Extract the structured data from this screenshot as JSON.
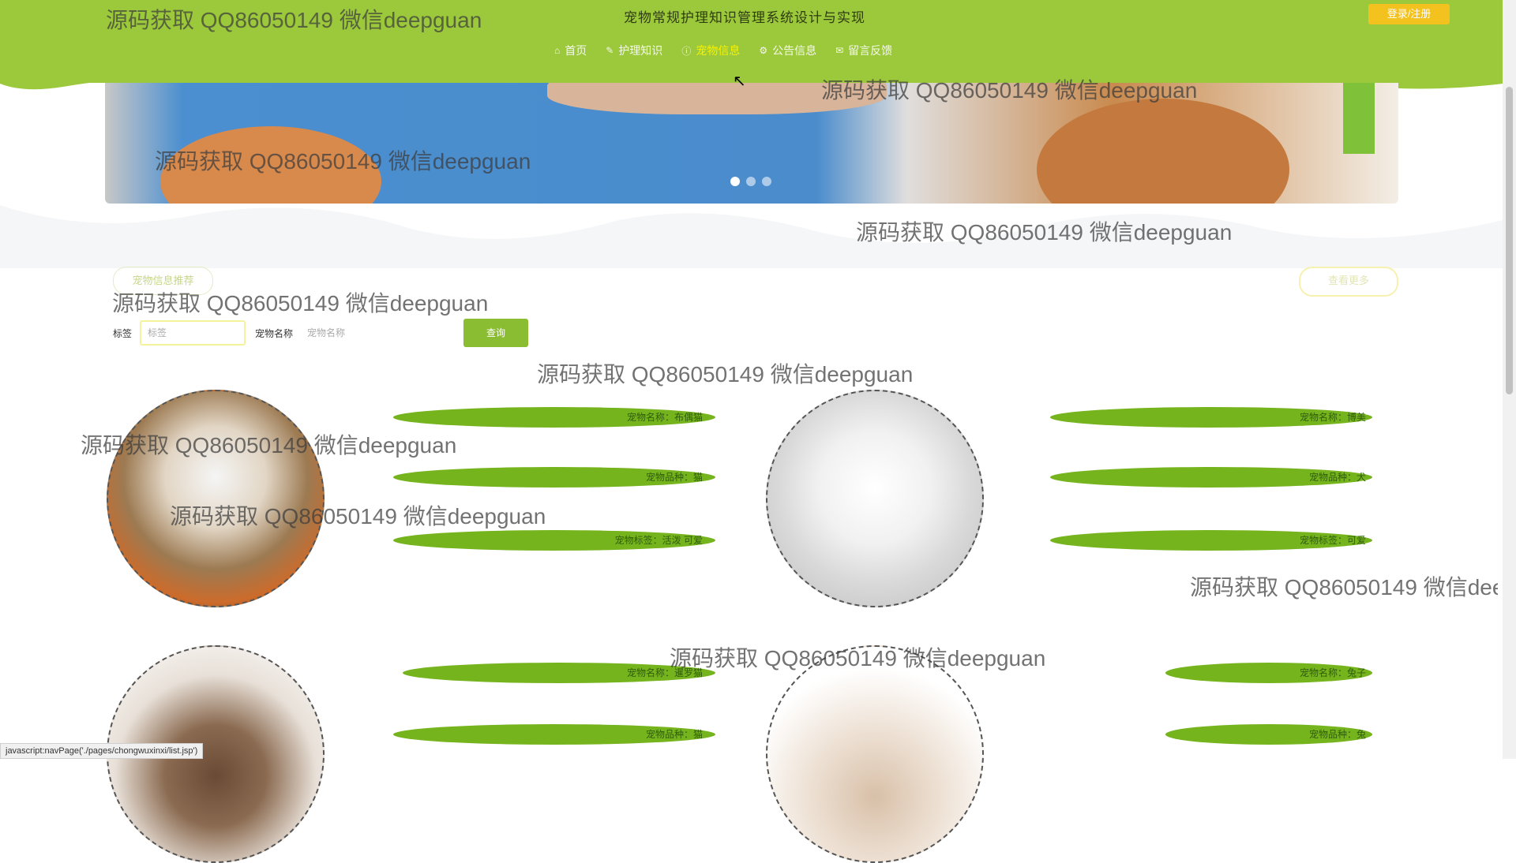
{
  "header": {
    "site_title": "宠物常规护理知识管理系统设计与实现",
    "login_label": "登录/注册",
    "nav": [
      {
        "icon": "home-icon",
        "glyph": "⌂",
        "label": "首页"
      },
      {
        "icon": "knowledge-icon",
        "glyph": "✎",
        "label": "护理知识"
      },
      {
        "icon": "info-icon",
        "glyph": "ⓘ",
        "label": "宠物信息"
      },
      {
        "icon": "notice-icon",
        "glyph": "⚙",
        "label": "公告信息"
      },
      {
        "icon": "message-icon",
        "glyph": "✉",
        "label": "留言反馈"
      }
    ]
  },
  "banner": {
    "slides": 3,
    "active": 1
  },
  "section": {
    "title": "宠物信息推荐",
    "more_label": "查看更多",
    "search": {
      "label1": "标签",
      "placeholder1": "标签",
      "label2": "宠物名称",
      "placeholder2": "宠物名称",
      "button": "查询"
    }
  },
  "cards": [
    {
      "lines": [
        "宠物名称：布偶猫",
        "宠物品种：猫",
        "宠物标签：活泼 可爱"
      ]
    },
    {
      "lines": [
        "宠物名称：博美",
        "宠物品种：犬",
        "宠物标签：可爱"
      ]
    },
    {
      "lines": [
        "宠物名称：暹罗猫",
        "宠物品种：猫"
      ]
    },
    {
      "lines": [
        "宠物名称：兔子",
        "宠物品种：兔"
      ]
    }
  ],
  "status_bar": "javascript:navPage('./pages/chongwuxinxi/list.jsp')",
  "watermark": "源码获取 QQ86050149 微信deepguan",
  "colors": {
    "header": "#9cc83b",
    "accent": "#75b41d",
    "login": "#f3c21e"
  }
}
